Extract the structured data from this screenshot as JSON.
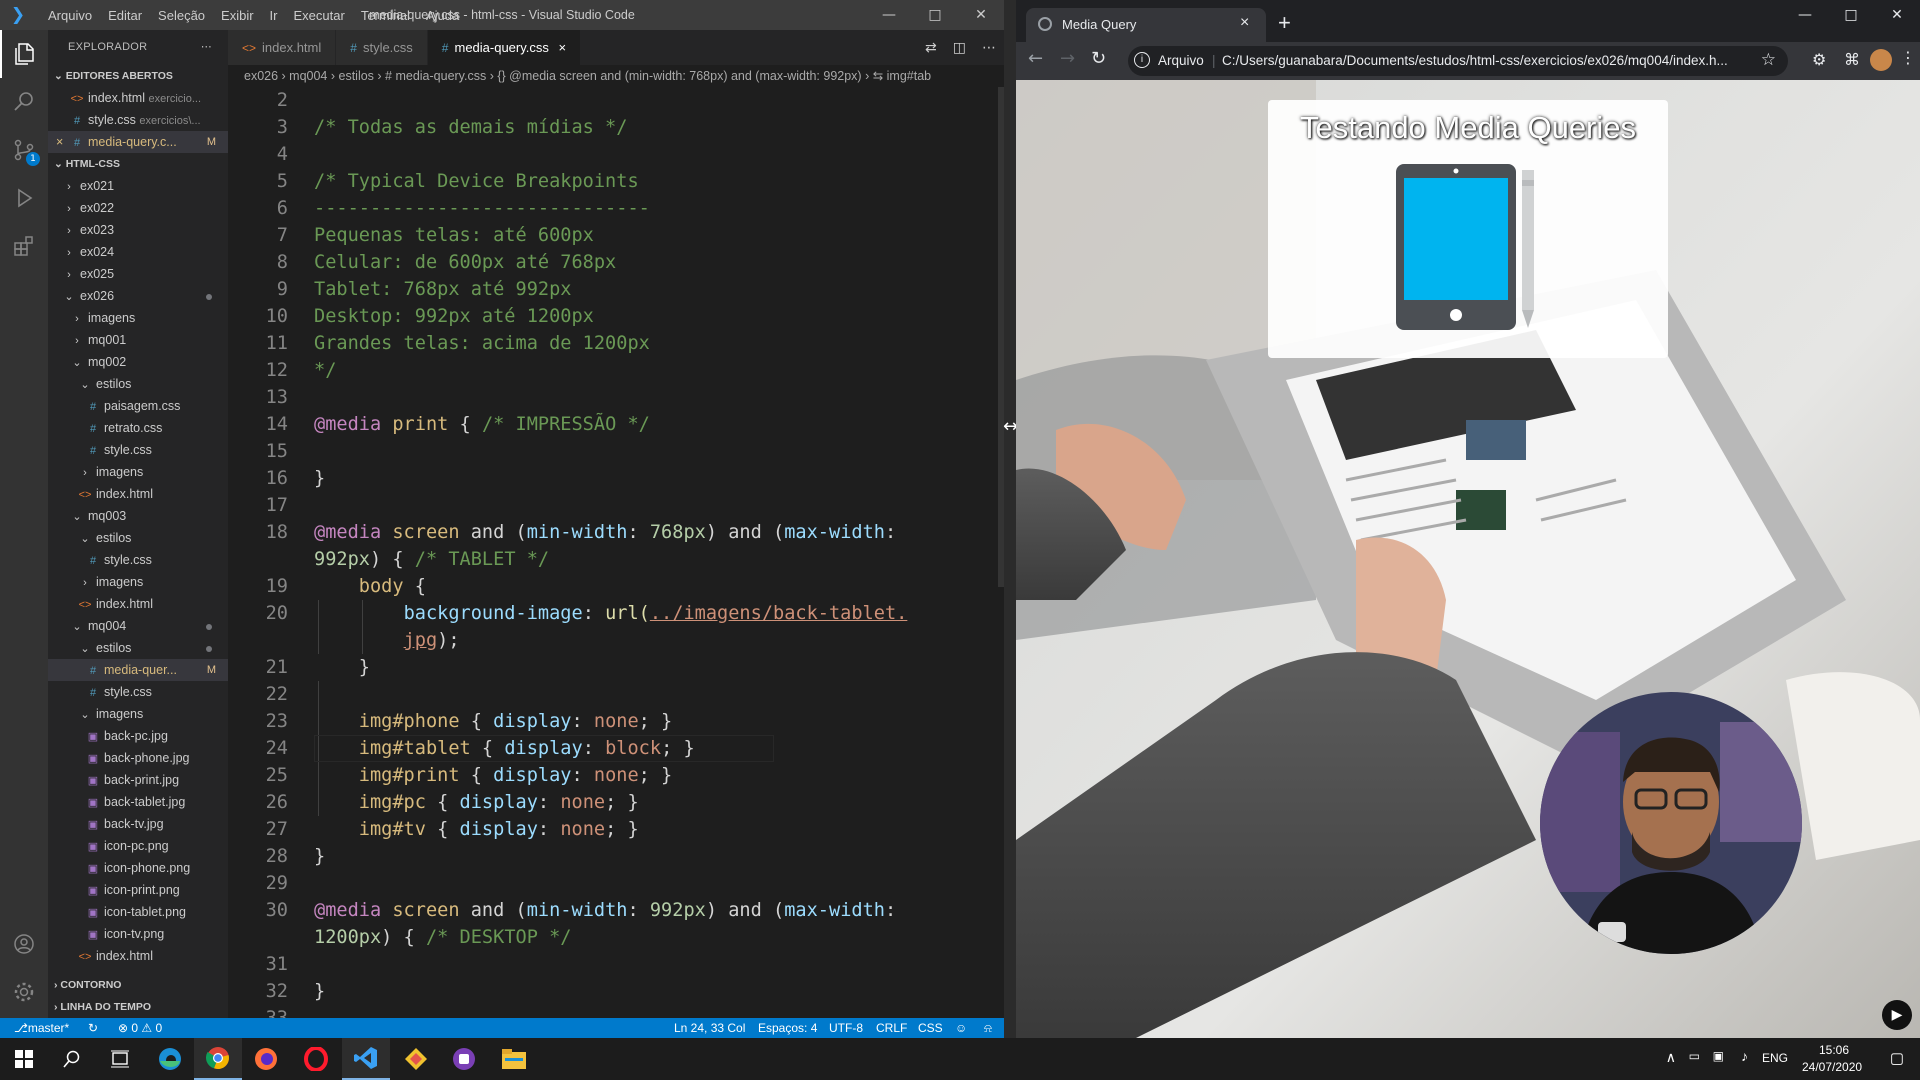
{
  "vscode": {
    "title": "media-query.css - html-css - Visual Studio Code",
    "menu": [
      "Arquivo",
      "Editar",
      "Seleção",
      "Exibir",
      "Ir",
      "Executar",
      "Terminal",
      "Ajuda"
    ],
    "explorer_title": "EXPLORADOR",
    "open_editors_label": "EDITORES ABERTOS",
    "open_editors": [
      {
        "name": "index.html",
        "hint": "exercicio...",
        "type": "html"
      },
      {
        "name": "style.css",
        "hint": "exercicios\\...",
        "type": "css"
      },
      {
        "name": "media-query.c...",
        "mark": "M",
        "type": "css",
        "close": "×",
        "selected": true
      }
    ],
    "workspace_label": "HTML-CSS",
    "tree": [
      {
        "name": "ex021",
        "indent": 1,
        "kind": "closed"
      },
      {
        "name": "ex022",
        "indent": 1,
        "kind": "closed"
      },
      {
        "name": "ex023",
        "indent": 1,
        "kind": "closed"
      },
      {
        "name": "ex024",
        "indent": 1,
        "kind": "closed"
      },
      {
        "name": "ex025",
        "indent": 1,
        "kind": "closed"
      },
      {
        "name": "ex026",
        "indent": 1,
        "kind": "open",
        "dot": true
      },
      {
        "name": "imagens",
        "indent": 2,
        "kind": "closed"
      },
      {
        "name": "mq001",
        "indent": 2,
        "kind": "closed"
      },
      {
        "name": "mq002",
        "indent": 2,
        "kind": "open"
      },
      {
        "name": "estilos",
        "indent": 3,
        "kind": "open"
      },
      {
        "name": "paisagem.css",
        "indent": 4,
        "kind": "css"
      },
      {
        "name": "retrato.css",
        "indent": 4,
        "kind": "css"
      },
      {
        "name": "style.css",
        "indent": 4,
        "kind": "css"
      },
      {
        "name": "imagens",
        "indent": 3,
        "kind": "closed"
      },
      {
        "name": "index.html",
        "indent": 3,
        "kind": "html"
      },
      {
        "name": "mq003",
        "indent": 2,
        "kind": "open"
      },
      {
        "name": "estilos",
        "indent": 3,
        "kind": "open"
      },
      {
        "name": "style.css",
        "indent": 4,
        "kind": "css"
      },
      {
        "name": "imagens",
        "indent": 3,
        "kind": "closed"
      },
      {
        "name": "index.html",
        "indent": 3,
        "kind": "html"
      },
      {
        "name": "mq004",
        "indent": 2,
        "kind": "open",
        "dot": true
      },
      {
        "name": "estilos",
        "indent": 3,
        "kind": "open",
        "dot": true
      },
      {
        "name": "media-quer...",
        "indent": 4,
        "kind": "css",
        "mark": "M",
        "selected": true
      },
      {
        "name": "style.css",
        "indent": 4,
        "kind": "css"
      },
      {
        "name": "imagens",
        "indent": 3,
        "kind": "open"
      },
      {
        "name": "back-pc.jpg",
        "indent": 4,
        "kind": "img"
      },
      {
        "name": "back-phone.jpg",
        "indent": 4,
        "kind": "img"
      },
      {
        "name": "back-print.jpg",
        "indent": 4,
        "kind": "img"
      },
      {
        "name": "back-tablet.jpg",
        "indent": 4,
        "kind": "img"
      },
      {
        "name": "back-tv.jpg",
        "indent": 4,
        "kind": "img"
      },
      {
        "name": "icon-pc.png",
        "indent": 4,
        "kind": "img"
      },
      {
        "name": "icon-phone.png",
        "indent": 4,
        "kind": "img"
      },
      {
        "name": "icon-print.png",
        "indent": 4,
        "kind": "img"
      },
      {
        "name": "icon-tablet.png",
        "indent": 4,
        "kind": "img"
      },
      {
        "name": "icon-tv.png",
        "indent": 4,
        "kind": "img"
      },
      {
        "name": "index.html",
        "indent": 3,
        "kind": "html"
      }
    ],
    "outline_label": "CONTORNO",
    "timeline_label": "LINHA DO TEMPO",
    "tabs": [
      {
        "label": "index.html",
        "type": "html"
      },
      {
        "label": "style.css",
        "type": "css"
      },
      {
        "label": "media-query.css",
        "type": "css",
        "active": true,
        "close": "×"
      }
    ],
    "breadcrumb": "ex026 › mq004 › estilos › # media-query.css › {} @media screen and (min-width: 768px) and (max-width: 992px) › ⇆ img#tab",
    "line_numbers": [
      "2",
      "3",
      "4",
      "5",
      "6",
      "7",
      "8",
      "9",
      "10",
      "11",
      "12",
      "13",
      "14",
      "15",
      "16",
      "17",
      "18",
      "",
      "19",
      "20",
      "",
      "21",
      "22",
      "23",
      "24",
      "25",
      "26",
      "27",
      "28",
      "29",
      "30",
      "",
      "31",
      "32",
      "33"
    ],
    "code_lines": [
      [],
      [
        {
          "t": "/* Todas as demais mídias */",
          "c": "cm"
        }
      ],
      [],
      [
        {
          "t": "/* Typical Device Breakpoints",
          "c": "cm"
        }
      ],
      [
        {
          "t": "------------------------------",
          "c": "cm"
        }
      ],
      [
        {
          "t": "Pequenas telas: até 600px",
          "c": "cm"
        }
      ],
      [
        {
          "t": "Celular: de 600px até 768px",
          "c": "cm"
        }
      ],
      [
        {
          "t": "Tablet: 768px até 992px",
          "c": "cm"
        }
      ],
      [
        {
          "t": "Desktop: 992px até 1200px",
          "c": "cm"
        }
      ],
      [
        {
          "t": "Grandes telas: acima de 1200px",
          "c": "cm"
        }
      ],
      [
        {
          "t": "*/",
          "c": "cm"
        }
      ],
      [],
      [
        {
          "t": "@media",
          "c": "kw"
        },
        {
          "t": " print ",
          "c": "sel"
        },
        {
          "t": "{ ",
          "c": ""
        },
        {
          "t": "/* IMPRESSÃO */",
          "c": "cm"
        }
      ],
      [],
      [
        {
          "t": "}",
          "c": ""
        }
      ],
      [],
      [
        {
          "t": "@media",
          "c": "kw"
        },
        {
          "t": " screen ",
          "c": "sel"
        },
        {
          "t": "and (",
          "c": ""
        },
        {
          "t": "min-width",
          "c": "pr"
        },
        {
          "t": ": ",
          "c": ""
        },
        {
          "t": "768px",
          "c": "num"
        },
        {
          "t": ") and (",
          "c": ""
        },
        {
          "t": "max-width",
          "c": "pr"
        },
        {
          "t": ":",
          "c": ""
        }
      ],
      [
        {
          "t": "992px",
          "c": "num"
        },
        {
          "t": ") { ",
          "c": ""
        },
        {
          "t": "/* TABLET */",
          "c": "cm"
        }
      ],
      [
        {
          "t": "    ",
          "c": ""
        },
        {
          "t": "body",
          "c": "sel"
        },
        {
          "t": " {",
          "c": ""
        }
      ],
      [
        {
          "t": "        ",
          "c": ""
        },
        {
          "t": "background-image",
          "c": "pr"
        },
        {
          "t": ": ",
          "c": ""
        },
        {
          "t": "url(",
          "c": "fn"
        },
        {
          "t": "../imagens/back-tablet.",
          "c": "lnk"
        }
      ],
      [
        {
          "t": "        ",
          "c": ""
        },
        {
          "t": "jpg",
          "c": "lnk"
        },
        {
          "t": ");",
          "c": ""
        }
      ],
      [
        {
          "t": "    }",
          "c": ""
        }
      ],
      [],
      [
        {
          "t": "    ",
          "c": ""
        },
        {
          "t": "img#phone",
          "c": "sel"
        },
        {
          "t": " { ",
          "c": ""
        },
        {
          "t": "display",
          "c": "pr"
        },
        {
          "t": ": ",
          "c": ""
        },
        {
          "t": "none",
          "c": "str"
        },
        {
          "t": "; }",
          "c": ""
        }
      ],
      [
        {
          "t": "    ",
          "c": ""
        },
        {
          "t": "img#tablet",
          "c": "sel"
        },
        {
          "t": " { ",
          "c": ""
        },
        {
          "t": "display",
          "c": "pr"
        },
        {
          "t": ": ",
          "c": ""
        },
        {
          "t": "block",
          "c": "str"
        },
        {
          "t": "; }",
          "c": ""
        }
      ],
      [
        {
          "t": "    ",
          "c": ""
        },
        {
          "t": "img#print",
          "c": "sel"
        },
        {
          "t": " { ",
          "c": ""
        },
        {
          "t": "display",
          "c": "pr"
        },
        {
          "t": ": ",
          "c": ""
        },
        {
          "t": "none",
          "c": "str"
        },
        {
          "t": "; }",
          "c": ""
        }
      ],
      [
        {
          "t": "    ",
          "c": ""
        },
        {
          "t": "img#pc",
          "c": "sel"
        },
        {
          "t": " { ",
          "c": ""
        },
        {
          "t": "display",
          "c": "pr"
        },
        {
          "t": ": ",
          "c": ""
        },
        {
          "t": "none",
          "c": "str"
        },
        {
          "t": "; }",
          "c": ""
        }
      ],
      [
        {
          "t": "    ",
          "c": ""
        },
        {
          "t": "img#tv",
          "c": "sel"
        },
        {
          "t": " { ",
          "c": ""
        },
        {
          "t": "display",
          "c": "pr"
        },
        {
          "t": ": ",
          "c": ""
        },
        {
          "t": "none",
          "c": "str"
        },
        {
          "t": "; }",
          "c": ""
        }
      ],
      [
        {
          "t": "}",
          "c": ""
        }
      ],
      [],
      [
        {
          "t": "@media",
          "c": "kw"
        },
        {
          "t": " screen ",
          "c": "sel"
        },
        {
          "t": "and (",
          "c": ""
        },
        {
          "t": "min-width",
          "c": "pr"
        },
        {
          "t": ": ",
          "c": ""
        },
        {
          "t": "992px",
          "c": "num"
        },
        {
          "t": ") and (",
          "c": ""
        },
        {
          "t": "max-width",
          "c": "pr"
        },
        {
          "t": ":",
          "c": ""
        }
      ],
      [
        {
          "t": "1200px",
          "c": "num"
        },
        {
          "t": ") { ",
          "c": ""
        },
        {
          "t": "/* DESKTOP */",
          "c": "cm"
        }
      ],
      [],
      [
        {
          "t": "}",
          "c": ""
        }
      ],
      []
    ],
    "status": {
      "branch": "master*",
      "errors": "⊗ 0 ⚠ 0",
      "position": "Ln 24, 33 Col",
      "spaces": "Espaços: 4",
      "encoding": "UTF-8",
      "eol": "CRLF",
      "language": "CSS"
    }
  },
  "chrome": {
    "tab_title": "Media Query",
    "tab_close": "×",
    "new_tab": "+",
    "address_prefix": "Arquivo",
    "address_url": "C:/Users/guanabara/Documents/estudos/html-css/exercicios/ex026/mq004/index.h...",
    "page_heading": "Testando Media Queries"
  },
  "taskbar": {
    "language": "ENG",
    "time": "15:06",
    "date": "24/07/2020"
  },
  "colors": {
    "vscode_accent": "#007acc",
    "tablet_screen": "#00b4ef",
    "tablet_body": "#4b4f54"
  }
}
